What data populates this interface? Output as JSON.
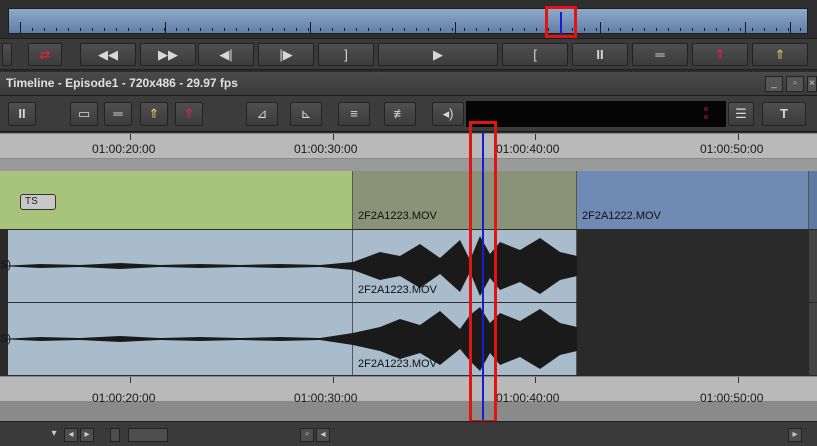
{
  "window": {
    "title": "Timeline - Episode1 - 720x486 - 29.97 fps"
  },
  "source_toolbar": {
    "buttons": [
      {
        "name": "mark-clip-button",
        "glyph": "⬚"
      },
      {
        "name": "splice-button",
        "glyph": "⇄"
      },
      {
        "name": "rewind-button",
        "glyph": "◀◀"
      },
      {
        "name": "fast-forward-button",
        "glyph": "▶▶"
      },
      {
        "name": "step-back-button",
        "glyph": "◀|"
      },
      {
        "name": "step-forward-button",
        "glyph": "|▶"
      },
      {
        "name": "mark-out-button",
        "glyph": "]"
      },
      {
        "name": "play-button",
        "glyph": "▶"
      },
      {
        "name": "mark-in-button",
        "glyph": "["
      },
      {
        "name": "mark-clip-source-button",
        "glyph": "II"
      },
      {
        "name": "clear-marks-button",
        "glyph": "═"
      },
      {
        "name": "extract-button",
        "glyph": "⇑"
      },
      {
        "name": "lift-button",
        "glyph": "⇑"
      }
    ]
  },
  "timeline_toolbar": {
    "buttons": [
      {
        "name": "mark-clip-tl-button",
        "glyph": "II"
      },
      {
        "name": "clear-in-tl-button",
        "glyph": "▭"
      },
      {
        "name": "clear-marks-tl-button",
        "glyph": "═"
      },
      {
        "name": "lift-tl-button",
        "glyph": "⇑"
      },
      {
        "name": "extract-tl-button",
        "glyph": "⇑"
      },
      {
        "name": "segment-mode-button",
        "glyph": "⊿"
      },
      {
        "name": "trim-mode-button",
        "glyph": "⊾"
      },
      {
        "name": "overwrite-button",
        "glyph": "≡"
      },
      {
        "name": "splice-in-button",
        "glyph": "≢"
      },
      {
        "name": "audio-button",
        "glyph": "◂)"
      }
    ],
    "menu_glyph": "☰",
    "text_tool_glyph": "T"
  },
  "timecodes": [
    "01:00:20:00",
    "01:00:30:00",
    "01:00:40:00",
    "01:00:50:00"
  ],
  "tracks": {
    "video_badge": "TS",
    "clips": {
      "v_a": "2F2A1223.MOV",
      "v_b": "2F2A1222.MOV",
      "a1": "2F2A1223.MOV",
      "a2": "2F2A1223.MOV"
    },
    "audio_left_label": "S)"
  },
  "scrollbar": {
    "left_glyph": "◂",
    "right_glyph": "▸",
    "menu_glyph": "▾"
  },
  "colors": {
    "video_track": "#a8c47a",
    "clip_grey": "#8a9278",
    "clip_blue": "#6f8bb3",
    "audio_track": "#a9bccb",
    "playhead": "#1c1ccf",
    "highlight": "#e31313"
  }
}
